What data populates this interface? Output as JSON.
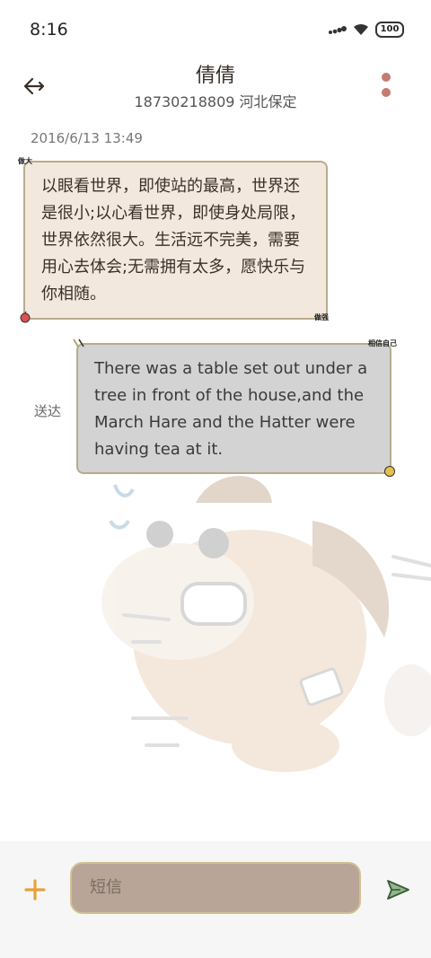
{
  "status_bar": {
    "time": "8:16",
    "battery_level": "100"
  },
  "header": {
    "contact_name": "倩倩",
    "contact_detail": "18730218809 河北保定"
  },
  "conversation": {
    "timestamp": "2016/6/13 13:49",
    "messages": [
      {
        "direction": "incoming",
        "text": "以眼看世界，即使站的最高，世界还是很小;以心看世界，即使身处局限，世界依然很大。生活远不完美，需要用心去体会;无需拥有太多，愿快乐与你相随。",
        "stickers": [
          "做大",
          "做强"
        ]
      },
      {
        "direction": "outgoing",
        "text": "There was a table set out under a tree in front of the house,and the March Hare and the Hatter were having tea at it.",
        "status": "送达",
        "stickers": [
          "相信自己"
        ]
      }
    ]
  },
  "composer": {
    "placeholder": "短信"
  },
  "icons": {
    "back": "back-arrow-icon",
    "more": "more-dots-icon",
    "add": "plus-icon",
    "send": "send-icon"
  },
  "colors": {
    "incoming_bubble": "#f3e8dd",
    "outgoing_bubble": "#d3d3d3",
    "bubble_border": "#b8ab8d",
    "input_field": "#b8a597",
    "accent_plus": "#e6a13a",
    "more_dots": "#c57a72"
  }
}
